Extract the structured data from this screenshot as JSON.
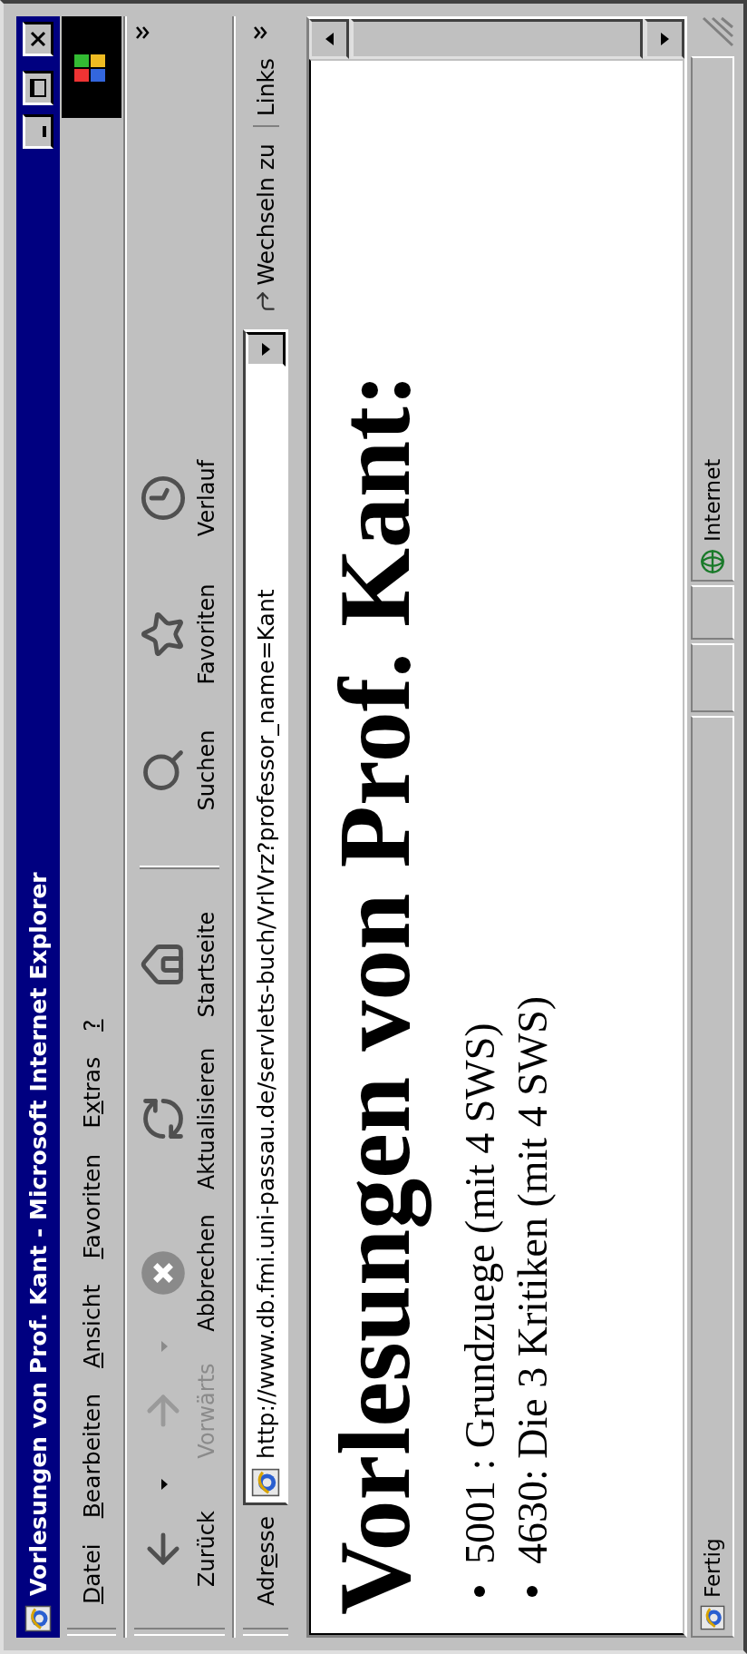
{
  "window": {
    "title": "Vorlesungen von Prof. Kant - Microsoft Internet Explorer"
  },
  "menu": [
    {
      "key": "D",
      "rest": "atei"
    },
    {
      "key": "B",
      "rest": "earbeiten"
    },
    {
      "key": "A",
      "rest": "nsicht"
    },
    {
      "key": "F",
      "rest": "avoriten"
    },
    {
      "lead": "E",
      "key": "x",
      "rest": "tras"
    },
    {
      "key": "?"
    }
  ],
  "toolbar": [
    {
      "kind": "back",
      "label": "Zurück",
      "disabled": false,
      "dropdown": true
    },
    {
      "kind": "forward",
      "label": "Vorwärts",
      "disabled": true,
      "dropdown": true
    },
    {
      "kind": "stop",
      "label": "Abbrechen",
      "disabled": false,
      "dropdown": false
    },
    {
      "kind": "refresh",
      "label": "Aktualisieren",
      "disabled": false,
      "dropdown": false
    },
    {
      "kind": "home",
      "label": "Startseite",
      "disabled": false,
      "dropdown": false
    },
    {
      "kind": "separator"
    },
    {
      "kind": "search",
      "label": "Suchen",
      "disabled": false,
      "dropdown": false
    },
    {
      "kind": "favorites",
      "label": "Favoriten",
      "disabled": false,
      "dropdown": false
    },
    {
      "kind": "history",
      "label": "Verlauf",
      "disabled": false,
      "dropdown": false
    }
  ],
  "address": {
    "lead": "Adr",
    "key": "e",
    "rest": "sse",
    "value": "http://www.db.fmi.uni-passau.de/servlets-buch/VrlVrz?professor_name=Kant",
    "go": "Wechseln zu",
    "links": "Links"
  },
  "page": {
    "heading": "Vorlesungen von Prof. Kant:",
    "items": [
      "5001 : Grundzuege (mit 4 SWS)",
      "4630: Die 3 Kritiken (mit 4 SWS)"
    ]
  },
  "status_bar": {
    "text": "Fertig",
    "zone": "Internet"
  }
}
